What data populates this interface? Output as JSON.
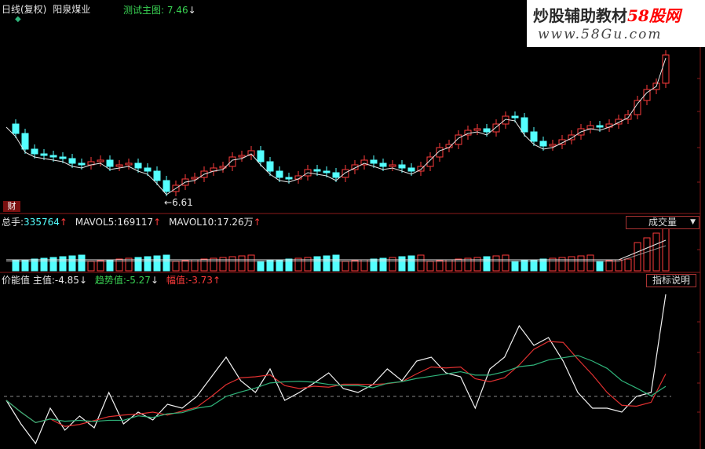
{
  "header": {
    "period": "日线(复权)",
    "stock_name": "阳泉煤业",
    "subchart_label": "测试主图: 7.46",
    "subchart_arrow": "↓"
  },
  "watermark": {
    "line1_prefix": "炒股辅助教材",
    "line1_brand": "58股网",
    "line2": "www.58Gu.com"
  },
  "main_chart": {
    "low_label": "6.61",
    "cai_badge": "财"
  },
  "volume": {
    "total_label": "总手:",
    "total_value": "335764",
    "mavol5_label": "MAVOL5:",
    "mavol5_value": "169117",
    "mavol10_label": "MAVOL10:",
    "mavol10_value": "17.26万",
    "up_arrow": "↑",
    "dropdown_label": "成交量",
    "dropdown_arrow": "▼"
  },
  "indicator": {
    "name": "价能值",
    "main_label": "主值:",
    "main_value": "-4.85",
    "main_arrow": "↓",
    "trend_label": "趋势值:",
    "trend_value": "-5.27",
    "trend_arrow": "↓",
    "amp_label": "幅值:",
    "amp_value": "-3.73",
    "amp_arrow": "↑",
    "help_button": "指标说明"
  },
  "colors": {
    "up": "#ff3b3b",
    "down": "#54ffff",
    "ma_white": "#e6e6e6",
    "ma_red": "#e03030",
    "ma_green": "#2fb37a",
    "frame": "#8b1a1a"
  }
}
